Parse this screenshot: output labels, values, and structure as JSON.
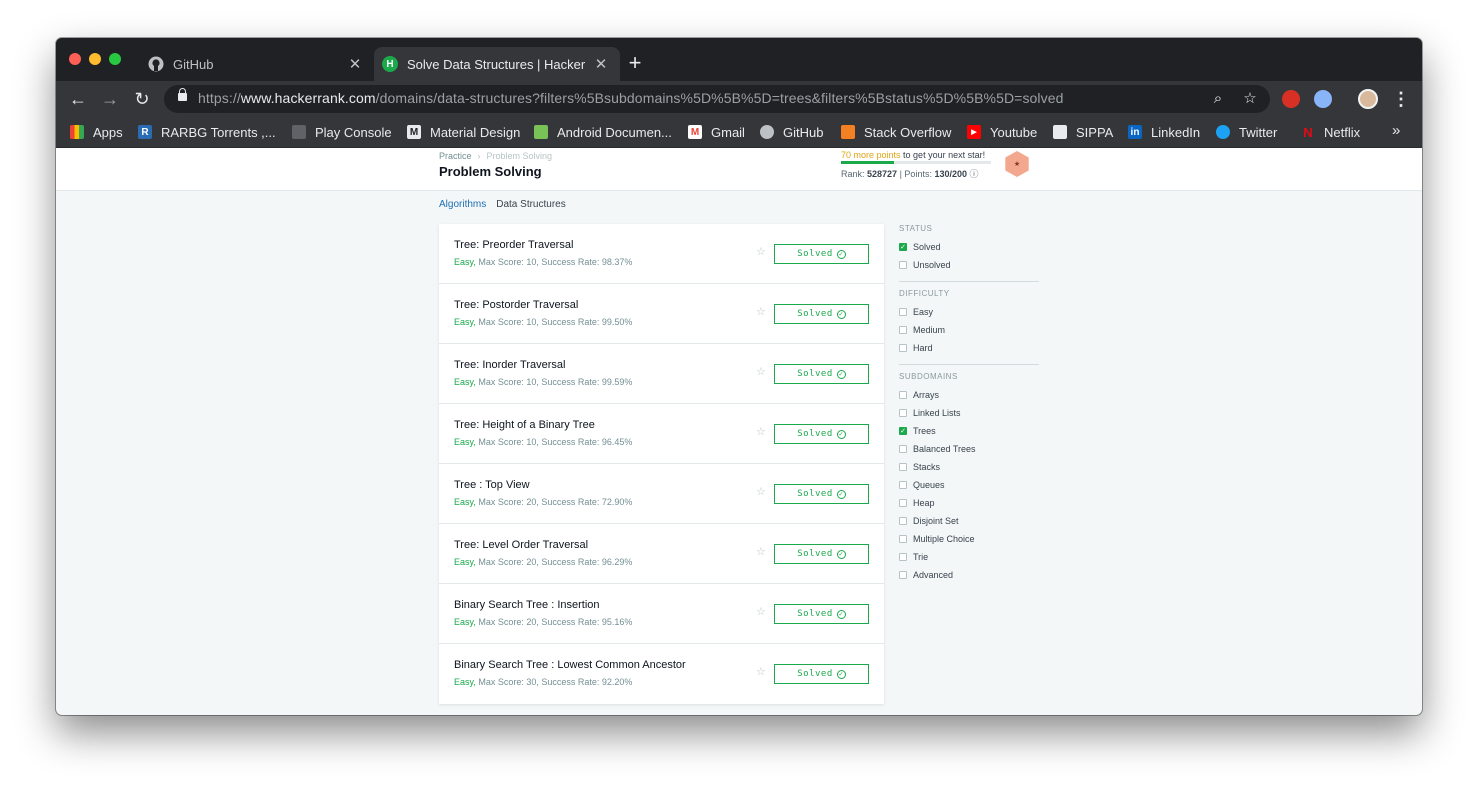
{
  "browser": {
    "tabs": [
      {
        "title": "GitHub",
        "active": false,
        "icon": "github-icon"
      },
      {
        "title": "Solve Data Structures | Hacker",
        "active": true,
        "icon": "hackerrank-icon"
      }
    ],
    "new_tab": "+",
    "url_scheme": "https://",
    "url_host": "www.hackerrank.com",
    "url_path": "/domains/data-structures?filters%5Bsubdomains%5D%5B%5D=trees&filters%5Bstatus%5D%5B%5D=solved",
    "bookmarks": [
      {
        "label": "Apps",
        "icon": "apps-grid-icon",
        "color": "#4285f4"
      },
      {
        "label": "RARBG Torrents ,...",
        "icon": "rarbg-icon",
        "color": "#2a6cb3"
      },
      {
        "label": "Play Console",
        "icon": "play-console-icon",
        "color": "#5f6368"
      },
      {
        "label": "Material Design",
        "icon": "material-design-icon",
        "color": "#e8eaed"
      },
      {
        "label": "Android Documen...",
        "icon": "android-icon",
        "color": "#78c257"
      },
      {
        "label": "Gmail",
        "icon": "gmail-icon",
        "color": "#ea4335"
      },
      {
        "label": "GitHub",
        "icon": "github-icon",
        "color": "#202124"
      },
      {
        "label": "Stack Overflow",
        "icon": "stackoverflow-icon",
        "color": "#f48024"
      },
      {
        "label": "Youtube",
        "icon": "youtube-icon",
        "color": "#ff0000"
      },
      {
        "label": "SIPPA",
        "icon": "sippa-icon",
        "color": "#e8eaed"
      },
      {
        "label": "LinkedIn",
        "icon": "linkedin-icon",
        "color": "#0a66c2"
      },
      {
        "label": "Twitter",
        "icon": "twitter-icon",
        "color": "#1da1f2"
      },
      {
        "label": "Netflix",
        "icon": "netflix-icon",
        "color": "#e50914"
      }
    ],
    "more_bookmarks": "»"
  },
  "header": {
    "breadcrumb": [
      "Practice",
      "Problem Solving"
    ],
    "title": "Problem Solving",
    "stars_points": "70 more points",
    "stars_rest": " to get your next star!",
    "rank_label": "Rank:",
    "rank_value": "528727",
    "points_label": "| Points:",
    "points_value": "130/200",
    "progress": 0.35
  },
  "subtabs": [
    "Algorithms",
    "Data Structures"
  ],
  "challenges": [
    {
      "name": "Tree: Preorder Traversal",
      "difficulty": "Easy,",
      "meta": " Max Score: 10, Success Rate: 98.37%",
      "status": "Solved"
    },
    {
      "name": "Tree: Postorder Traversal",
      "difficulty": "Easy,",
      "meta": " Max Score: 10, Success Rate: 99.50%",
      "status": "Solved"
    },
    {
      "name": "Tree: Inorder Traversal",
      "difficulty": "Easy,",
      "meta": " Max Score: 10, Success Rate: 99.59%",
      "status": "Solved"
    },
    {
      "name": "Tree: Height of a Binary Tree",
      "difficulty": "Easy,",
      "meta": " Max Score: 10, Success Rate: 96.45%",
      "status": "Solved"
    },
    {
      "name": "Tree : Top View",
      "difficulty": "Easy,",
      "meta": " Max Score: 20, Success Rate: 72.90%",
      "status": "Solved"
    },
    {
      "name": "Tree: Level Order Traversal",
      "difficulty": "Easy,",
      "meta": " Max Score: 20, Success Rate: 96.29%",
      "status": "Solved"
    },
    {
      "name": "Binary Search Tree : Insertion",
      "difficulty": "Easy,",
      "meta": " Max Score: 20, Success Rate: 95.16%",
      "status": "Solved"
    },
    {
      "name": "Binary Search Tree : Lowest Common Ancestor",
      "difficulty": "Easy,",
      "meta": " Max Score: 30, Success Rate: 92.20%",
      "status": "Solved"
    }
  ],
  "filters": [
    {
      "title": "STATUS",
      "items": [
        {
          "label": "Solved",
          "checked": true
        },
        {
          "label": "Unsolved",
          "checked": false
        }
      ]
    },
    {
      "title": "DIFFICULTY",
      "items": [
        {
          "label": "Easy",
          "checked": false
        },
        {
          "label": "Medium",
          "checked": false
        },
        {
          "label": "Hard",
          "checked": false
        }
      ]
    },
    {
      "title": "SUBDOMAINS",
      "items": [
        {
          "label": "Arrays",
          "checked": false
        },
        {
          "label": "Linked Lists",
          "checked": false
        },
        {
          "label": "Trees",
          "checked": true
        },
        {
          "label": "Balanced Trees",
          "checked": false
        },
        {
          "label": "Stacks",
          "checked": false
        },
        {
          "label": "Queues",
          "checked": false
        },
        {
          "label": "Heap",
          "checked": false
        },
        {
          "label": "Disjoint Set",
          "checked": false
        },
        {
          "label": "Multiple Choice",
          "checked": false
        },
        {
          "label": "Trie",
          "checked": false
        },
        {
          "label": "Advanced",
          "checked": false
        }
      ]
    }
  ],
  "colors": {
    "accent_green": "#1ba94c",
    "link_blue": "#1f6fb5",
    "page_bg": "#f3f7f7"
  }
}
